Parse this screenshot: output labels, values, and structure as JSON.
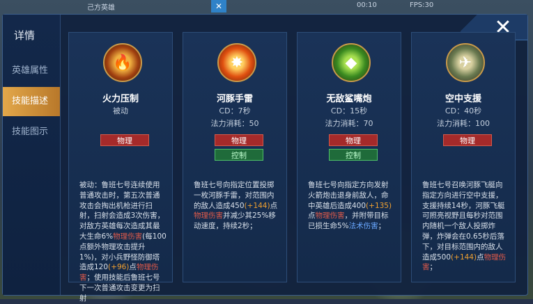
{
  "topbar": {
    "team": "己方英雄",
    "timer": "00:10",
    "fps": "FPS:30"
  },
  "sidebar": {
    "title": "详情",
    "items": [
      {
        "label": "英雄属性",
        "active": false
      },
      {
        "label": "技能描述",
        "active": true
      },
      {
        "label": "技能图示",
        "active": false
      }
    ]
  },
  "close_label": "✕",
  "skills": [
    {
      "name": "火力压制",
      "line1": "被动",
      "line2": "",
      "tags": [
        {
          "label": "物理",
          "color": "red"
        }
      ],
      "icon": "fire-suppression-icon",
      "desc": [
        {
          "t": "被动：鲁班七号连续使用普通攻击时，第五次普通攻击会掏出机枪进行扫射，扫射会造成3次伤害，对敌方英雄每次造成其最大生命6%"
        },
        {
          "t": "物理伤害",
          "c": "red"
        },
        {
          "t": "(每100点额外物理攻击提升1%)，对小兵野怪防御塔造成120"
        },
        {
          "t": "(+96)",
          "c": "orange"
        },
        {
          "t": "点"
        },
        {
          "t": "物理伤害",
          "c": "red"
        },
        {
          "t": "；使用技能后鲁班七号下一次普通攻击变更为扫射"
        }
      ]
    },
    {
      "name": "河豚手雷",
      "line1": "CD：7秒",
      "line2": "法力消耗：50",
      "tags": [
        {
          "label": "物理",
          "color": "red"
        },
        {
          "label": "控制",
          "color": "green"
        }
      ],
      "icon": "pufferfish-grenade-icon",
      "desc": [
        {
          "t": "鲁班七号向指定位置投掷一枚河豚手雷，对范围内的敌人造成450"
        },
        {
          "t": "(+144)",
          "c": "orange"
        },
        {
          "t": "点"
        },
        {
          "t": "物理伤害",
          "c": "red"
        },
        {
          "t": "并减少其25%移动速度，持续2秒；"
        }
      ]
    },
    {
      "name": "无敌鲨嘴炮",
      "line1": "CD：15秒",
      "line2": "法力消耗：70",
      "tags": [
        {
          "label": "物理",
          "color": "red"
        },
        {
          "label": "控制",
          "color": "green"
        }
      ],
      "icon": "shark-cannon-icon",
      "desc": [
        {
          "t": "鲁班七号向指定方向发射火箭炮击退身前敌人，命中英雄后造成400"
        },
        {
          "t": "(+135)",
          "c": "orange"
        },
        {
          "t": "点"
        },
        {
          "t": "物理伤害",
          "c": "red"
        },
        {
          "t": "，并附带目标已损生命5%"
        },
        {
          "t": "法术伤害",
          "c": "blue"
        },
        {
          "t": "；"
        }
      ]
    },
    {
      "name": "空中支援",
      "line1": "CD：40秒",
      "line2": "法力消耗：100",
      "tags": [
        {
          "label": "物理",
          "color": "red"
        }
      ],
      "icon": "air-support-icon",
      "desc": [
        {
          "t": "鲁班七号召唤河豚飞艇向指定方向进行空中支援，支援持续14秒，河豚飞艇可照亮视野且每秒对范围内随机一个敌人投掷炸弹，炸弹会在0.65秒后落下，对目标范围内的敌人造成500"
        },
        {
          "t": "(+144)",
          "c": "orange"
        },
        {
          "t": "点"
        },
        {
          "t": "物理伤害",
          "c": "red"
        },
        {
          "t": "；"
        }
      ]
    }
  ]
}
